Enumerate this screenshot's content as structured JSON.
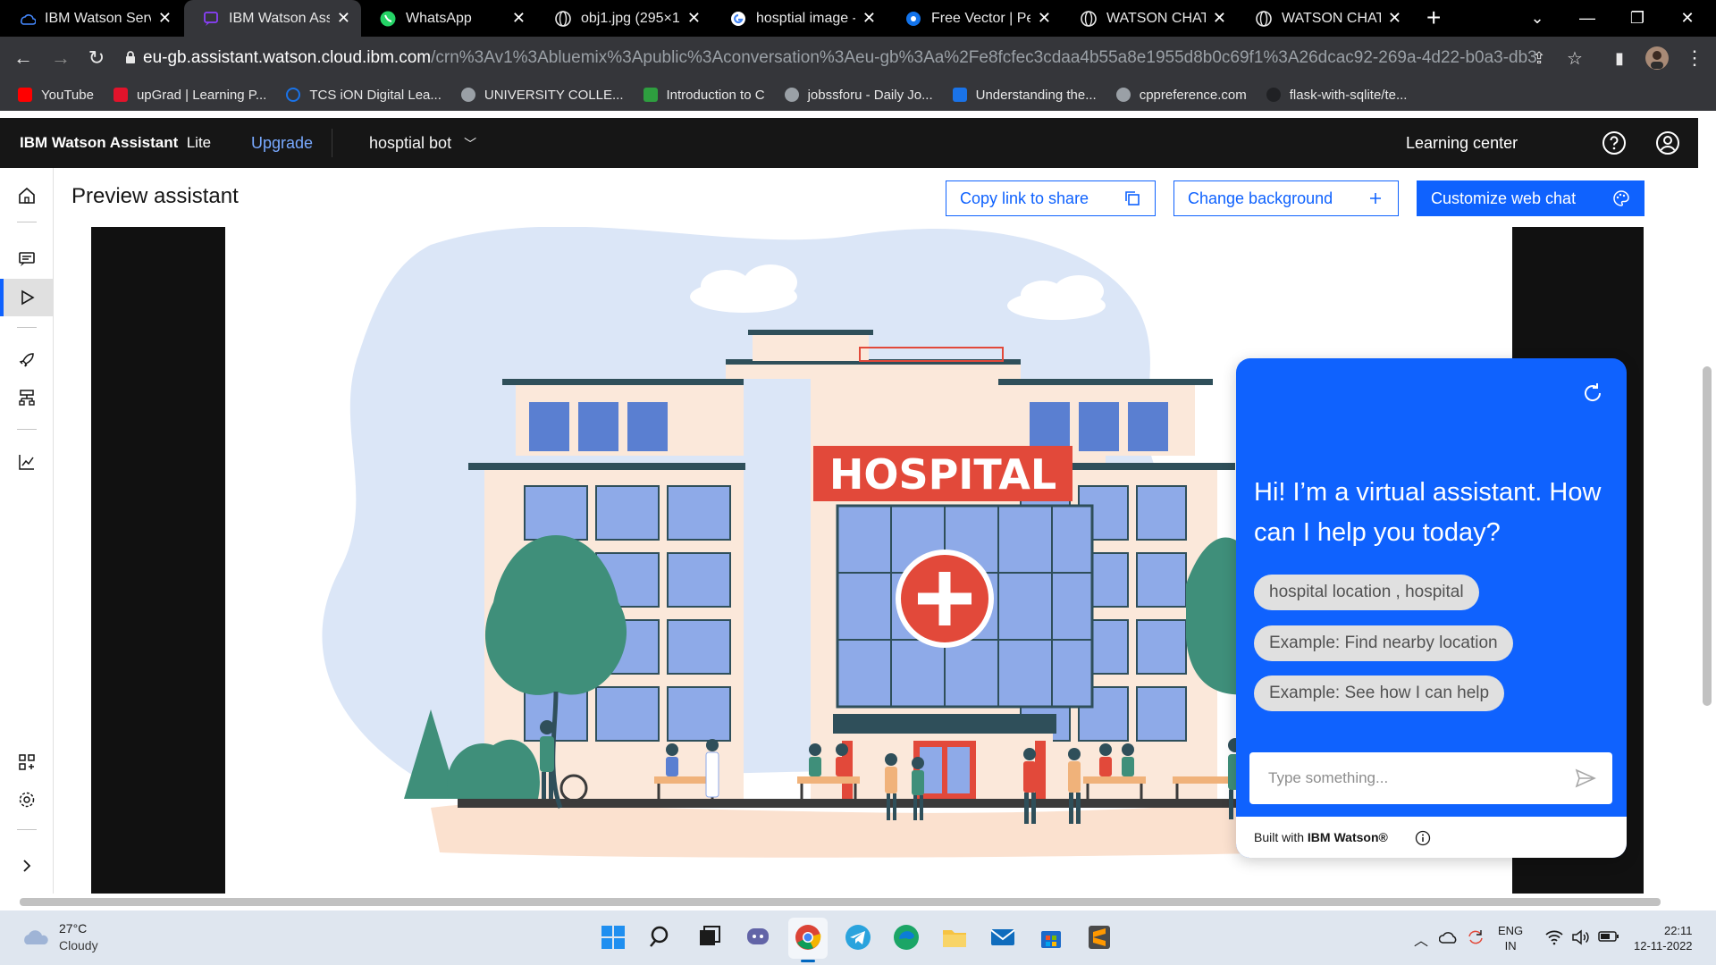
{
  "browser": {
    "tabs": [
      {
        "label": "IBM Watson Servi",
        "icon": "ibm-cloud-icon",
        "active": false
      },
      {
        "label": "IBM Watson Assis",
        "icon": "watson-assistant-icon",
        "active": true
      },
      {
        "label": "WhatsApp",
        "icon": "whatsapp-icon",
        "active": false
      },
      {
        "label": "obj1.jpg (295×17",
        "icon": "globe-icon",
        "active": false
      },
      {
        "label": "hosptial image - (",
        "icon": "google-icon",
        "active": false
      },
      {
        "label": "Free Vector | Peop",
        "icon": "freepik-icon",
        "active": false
      },
      {
        "label": "WATSON CHATB(",
        "icon": "globe-icon",
        "active": false
      },
      {
        "label": "WATSON CHATB(",
        "icon": "globe-icon",
        "active": false
      }
    ],
    "url_host": "eu-gb.assistant.watson.cloud.ibm.com",
    "url_path": "/crn%3Av1%3Abluemix%3Apublic%3Aconversation%3Aeu-gb%3Aa%2Fe8fcfec3cdaa4b55a8e1955d8b0c69f1%3A26dcac92-269a-4d22-b0a3-db38a01c162c%...",
    "bookmarks": [
      {
        "label": "YouTube",
        "color": "#ff0000"
      },
      {
        "label": "upGrad | Learning P...",
        "color": "#e2132b"
      },
      {
        "label": "TCS iON Digital Lea...",
        "color": "#1a73e8"
      },
      {
        "label": "UNIVERSITY COLLE...",
        "color": "#9aa0a6"
      },
      {
        "label": "Introduction to C",
        "color": "#2e9e3f"
      },
      {
        "label": "jobssforu - Daily Jo...",
        "color": "#9aa0a6"
      },
      {
        "label": "Understanding the...",
        "color": "#1a73e8"
      },
      {
        "label": "cppreference.com",
        "color": "#9aa0a6"
      },
      {
        "label": "flask-with-sqlite/te...",
        "color": "#35363a"
      }
    ]
  },
  "header": {
    "product": "IBM Watson Assistant",
    "plan": "Lite",
    "upgrade": "Upgrade",
    "bot_name": "hosptial bot",
    "learning_center": "Learning center"
  },
  "preview": {
    "title": "Preview assistant",
    "copy_link": "Copy link to share",
    "change_background": "Change background",
    "customize": "Customize web chat"
  },
  "illustration": {
    "sign": "HOSPITAL"
  },
  "chat": {
    "greeting": "Hi! I’m a virtual assistant. How can I help you today?",
    "suggestions": [
      "hospital location , hospital",
      "Example: Find nearby location",
      "Example: See how I can help"
    ],
    "input_placeholder": "Type something...",
    "built_with": "Built with",
    "brand": "IBM Watson®"
  },
  "taskbar": {
    "temperature": "27°C",
    "condition": "Cloudy",
    "lang": "ENG",
    "region": "IN",
    "time": "22:11",
    "date": "12-11-2022"
  },
  "colors": {
    "ibm_blue": "#0f62fe",
    "header_bg": "#161616",
    "hospital_red": "#e2493a"
  }
}
